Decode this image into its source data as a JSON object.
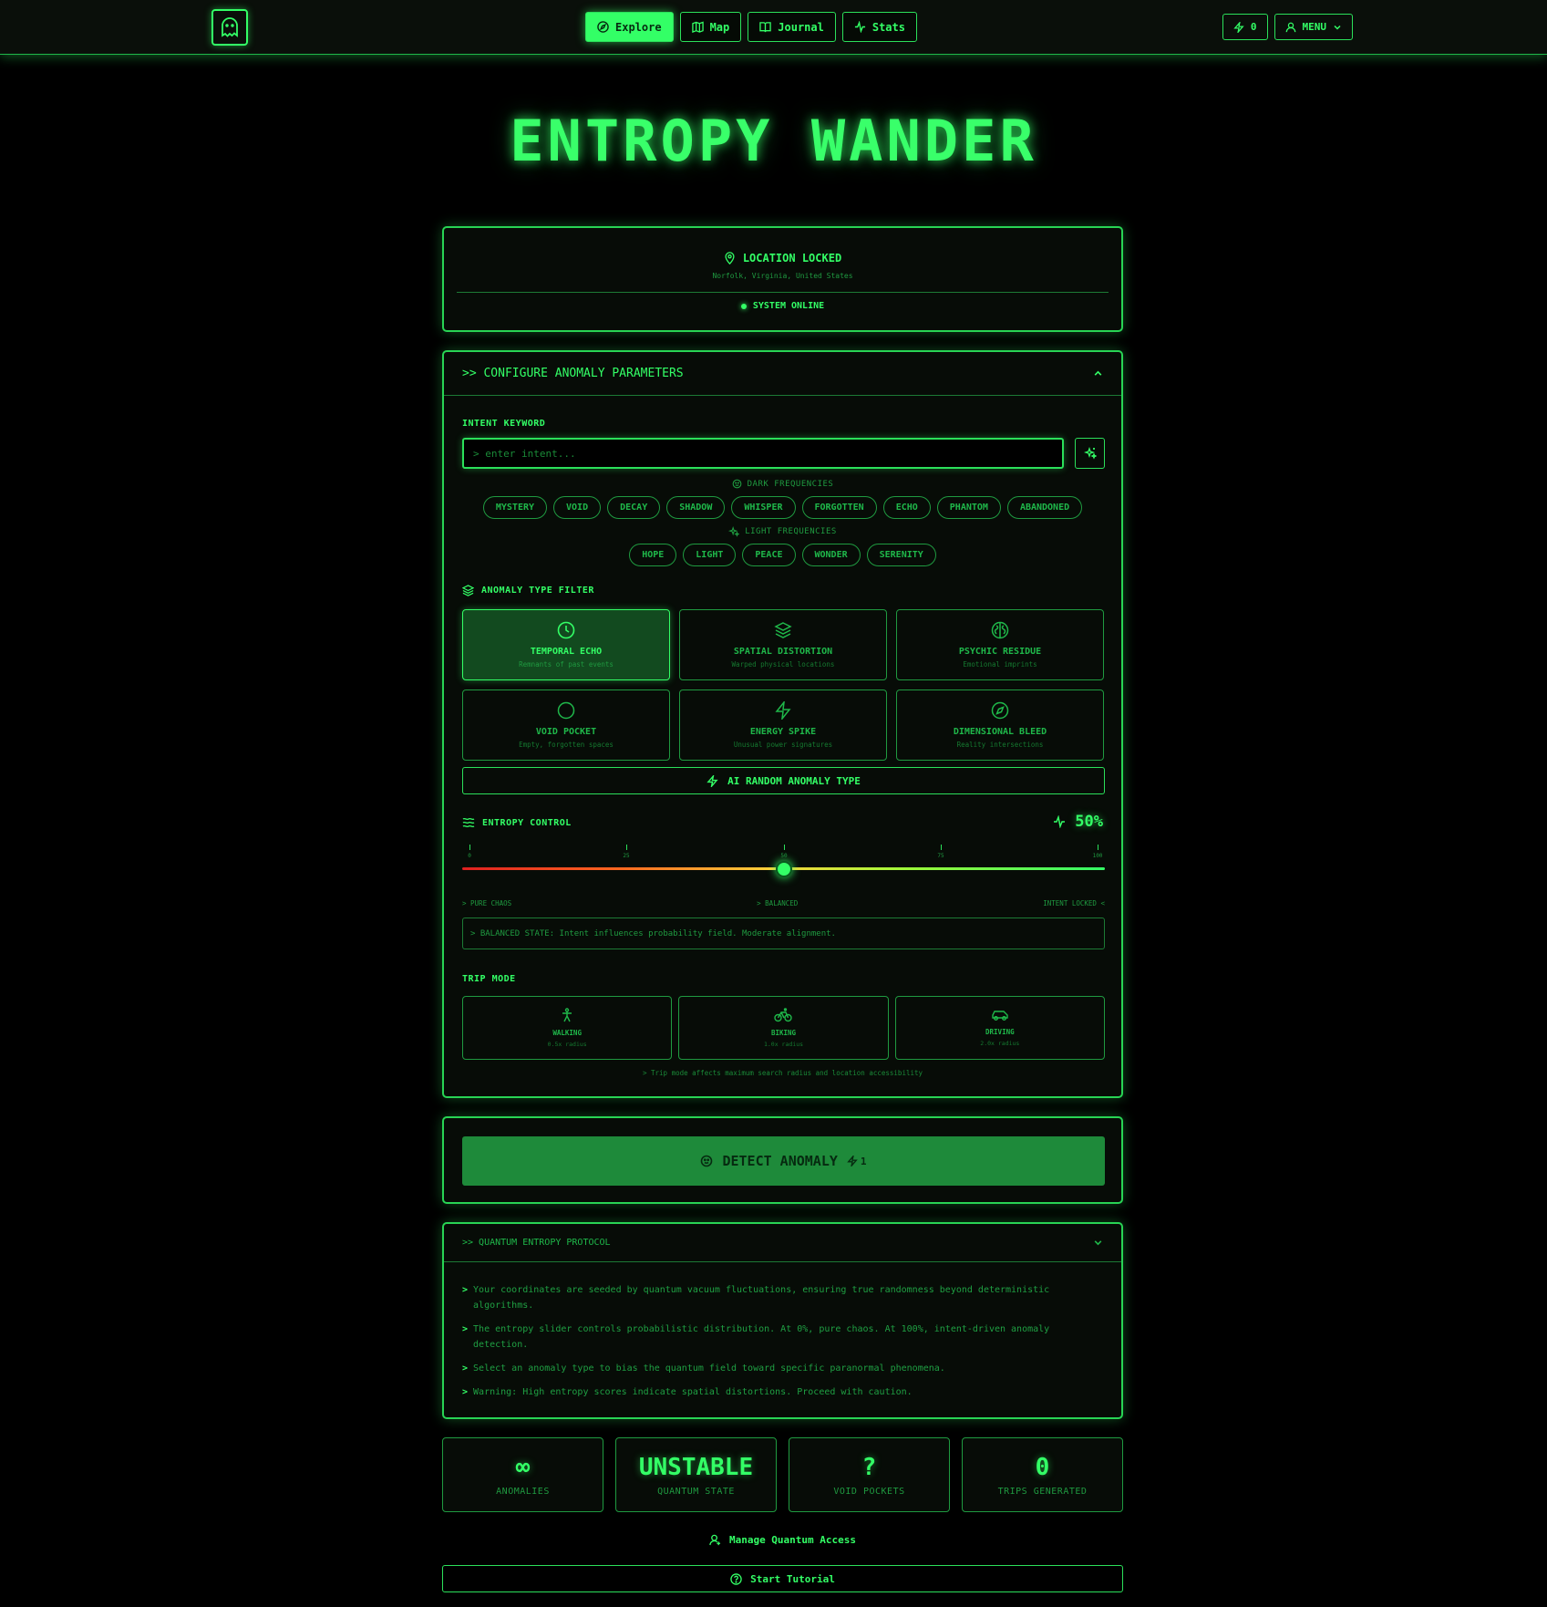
{
  "nav": {
    "items": [
      {
        "label": "Explore",
        "icon": "compass-icon",
        "active": true
      },
      {
        "label": "Map",
        "icon": "map-icon",
        "active": false
      },
      {
        "label": "Journal",
        "icon": "book-icon",
        "active": false
      },
      {
        "label": "Stats",
        "icon": "activity-icon",
        "active": false
      }
    ],
    "energy_count": "0",
    "menu_label": "MENU"
  },
  "hero": {
    "title": "ENTROPY WANDER"
  },
  "location": {
    "title": "LOCATION LOCKED",
    "place": "Norfolk, Virginia, United States",
    "status": "SYSTEM ONLINE"
  },
  "config": {
    "header": ">> CONFIGURE ANOMALY PARAMETERS",
    "intent_label": "INTENT KEYWORD",
    "intent_placeholder": "> enter intent...",
    "dark_label": "DARK FREQUENCIES",
    "dark_chips": [
      "MYSTERY",
      "VOID",
      "DECAY",
      "SHADOW",
      "WHISPER",
      "FORGOTTEN",
      "ECHO",
      "PHANTOM",
      "ABANDONED"
    ],
    "light_label": "LIGHT FREQUENCIES",
    "light_chips": [
      "HOPE",
      "LIGHT",
      "PEACE",
      "WONDER",
      "SERENITY"
    ],
    "anomaly_label": "ANOMALY TYPE FILTER",
    "anomalies": [
      {
        "title": "TEMPORAL ECHO",
        "desc": "Remnants of past events",
        "icon": "clock-icon",
        "selected": true
      },
      {
        "title": "SPATIAL DISTORTION",
        "desc": "Warped physical locations",
        "icon": "layers-icon",
        "selected": false
      },
      {
        "title": "PSYCHIC RESIDUE",
        "desc": "Emotional imprints",
        "icon": "brain-icon",
        "selected": false
      },
      {
        "title": "VOID POCKET",
        "desc": "Empty, forgotten spaces",
        "icon": "circle-icon",
        "selected": false
      },
      {
        "title": "ENERGY SPIKE",
        "desc": "Unusual power signatures",
        "icon": "lightning-icon",
        "selected": false
      },
      {
        "title": "DIMENSIONAL BLEED",
        "desc": "Reality intersections",
        "icon": "compass-icon",
        "selected": false
      }
    ],
    "ai_random_label": "AI RANDOM ANOMALY TYPE",
    "entropy_label": "ENTROPY CONTROL",
    "entropy_value": 50,
    "entropy_display": "50%",
    "ticks": [
      "0",
      "25",
      "50",
      "75",
      "100"
    ],
    "range_left": "> PURE CHAOS",
    "range_mid": "> BALANCED",
    "range_right": "INTENT LOCKED <",
    "state_text": "> BALANCED STATE: Intent influences probability field. Moderate alignment.",
    "trip_label": "TRIP MODE",
    "trips": [
      {
        "title": "WALKING",
        "sub": "0.5x radius",
        "icon": "walking-icon"
      },
      {
        "title": "BIKING",
        "sub": "1.0x radius",
        "icon": "bike-icon"
      },
      {
        "title": "DRIVING",
        "sub": "2.0x radius",
        "icon": "car-icon"
      }
    ],
    "trip_note": "> Trip mode affects maximum search radius and location accessibility"
  },
  "detect": {
    "label": "DETECT ANOMALY",
    "cost": "1"
  },
  "protocol": {
    "header": ">> QUANTUM ENTROPY PROTOCOL",
    "items": [
      "Your coordinates are seeded by quantum vacuum fluctuations, ensuring true randomness beyond deterministic algorithms.",
      "The entropy slider controls probabilistic distribution. At 0%, pure chaos. At 100%, intent-driven anomaly detection.",
      "Select an anomaly type to bias the quantum field toward specific paranormal phenomena.",
      "Warning: High entropy scores indicate spatial distortions. Proceed with caution."
    ]
  },
  "stats": [
    {
      "value": "∞",
      "label": "ANOMALIES"
    },
    {
      "value": "UNSTABLE",
      "label": "QUANTUM STATE"
    },
    {
      "value": "?",
      "label": "VOID POCKETS"
    },
    {
      "value": "0",
      "label": "TRIPS GENERATED"
    }
  ],
  "footer": {
    "manage_label": "Manage Quantum Access",
    "tutorial_label": "Start Tutorial"
  },
  "colors": {
    "accent": "#33ff66",
    "background": "#000000",
    "selected_bg": "#124a1f",
    "detect_bg": "#1e8a3a"
  }
}
